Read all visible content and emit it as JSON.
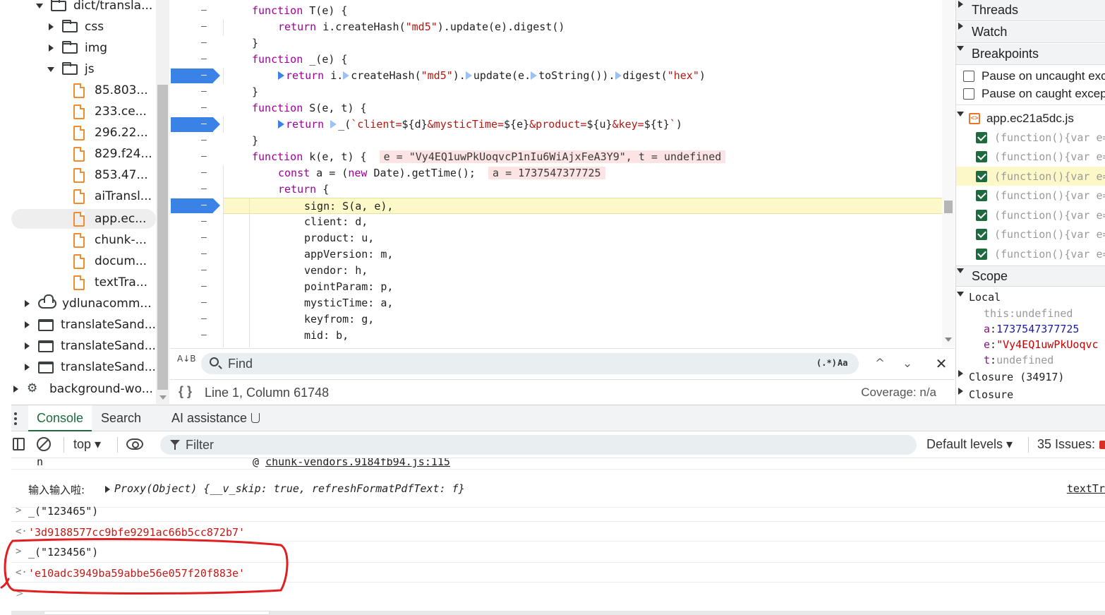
{
  "file_tree": {
    "items": [
      {
        "label": "dict/transla...",
        "type": "folder",
        "expanded": true
      },
      {
        "label": "css",
        "type": "folder",
        "expanded": false
      },
      {
        "label": "img",
        "type": "folder",
        "expanded": false
      },
      {
        "label": "js",
        "type": "folder",
        "expanded": true
      },
      {
        "label": "85.803...",
        "type": "file"
      },
      {
        "label": "233.ce...",
        "type": "file"
      },
      {
        "label": "296.22...",
        "type": "file"
      },
      {
        "label": "829.f24...",
        "type": "file"
      },
      {
        "label": "853.47...",
        "type": "file"
      },
      {
        "label": "aiTransl...",
        "type": "file"
      },
      {
        "label": "app.ec...",
        "type": "file",
        "selected": true
      },
      {
        "label": "chunk-...",
        "type": "file"
      },
      {
        "label": "docum...",
        "type": "file"
      },
      {
        "label": "textTra...",
        "type": "file"
      },
      {
        "label": "ydlunacomm...",
        "type": "cloud"
      },
      {
        "label": "translateSand...",
        "type": "frame"
      },
      {
        "label": "translateSand...",
        "type": "frame"
      },
      {
        "label": "translateSand...",
        "type": "frame"
      },
      {
        "label": "background-wo...",
        "type": "gear"
      }
    ]
  },
  "editor": {
    "gutter_symbol": "–",
    "breakpoint_lines": [
      4,
      7,
      12
    ],
    "lines": [
      {
        "indent": 0,
        "parts": [
          [
            "kw",
            "function"
          ],
          [
            "",
            " T(e) {"
          ]
        ]
      },
      {
        "indent": 1,
        "parts": [
          [
            "kw",
            "return"
          ],
          [
            "",
            " i.createHash("
          ],
          [
            "str",
            "\"md5\""
          ],
          [
            "",
            ").update(e).digest()"
          ]
        ]
      },
      {
        "indent": 0,
        "parts": [
          [
            "",
            "}"
          ]
        ]
      },
      {
        "indent": 0,
        "parts": [
          [
            "kw",
            "function"
          ],
          [
            "",
            " _(e) {"
          ]
        ]
      },
      {
        "indent": 1,
        "parts": [
          [
            "bp",
            ""
          ],
          [
            "kw",
            "return"
          ],
          [
            "",
            " i."
          ],
          [
            "bpoff",
            ""
          ],
          [
            "",
            "createHash("
          ],
          [
            "str",
            "\"md5\""
          ],
          [
            "",
            ")."
          ],
          [
            "bpoff",
            ""
          ],
          [
            "",
            "update(e."
          ],
          [
            "bpoff",
            ""
          ],
          [
            "",
            "toString())."
          ],
          [
            "bpoff",
            ""
          ],
          [
            "",
            "digest("
          ],
          [
            "str",
            "\"hex\""
          ],
          [
            "",
            ")"
          ]
        ]
      },
      {
        "indent": 0,
        "parts": [
          [
            "",
            "}"
          ]
        ]
      },
      {
        "indent": 0,
        "parts": [
          [
            "kw",
            "function"
          ],
          [
            "",
            " S(e, t) {"
          ]
        ]
      },
      {
        "indent": 1,
        "parts": [
          [
            "bp",
            ""
          ],
          [
            "kw",
            "return"
          ],
          [
            "",
            " "
          ],
          [
            "bpoff",
            ""
          ],
          [
            "",
            "_("
          ],
          [
            "str",
            "`client="
          ],
          [
            "",
            "${d}"
          ],
          [
            "str",
            "&mysticTime="
          ],
          [
            "",
            "${e}"
          ],
          [
            "str",
            "&product="
          ],
          [
            "",
            "${u}"
          ],
          [
            "str",
            "&key="
          ],
          [
            "",
            "${t}"
          ],
          [
            "str",
            "`"
          ],
          [
            "",
            ")"
          ]
        ]
      },
      {
        "indent": 0,
        "parts": [
          [
            "",
            "}"
          ]
        ]
      },
      {
        "indent": 0,
        "parts": [
          [
            "kw",
            "function"
          ],
          [
            "",
            " k(e, t) {  "
          ],
          [
            "inline",
            "e = \"Vy4EQ1uwPkUoqvcP1nIu6WiAjxFeA3Y9\", t = undefined"
          ]
        ]
      },
      {
        "indent": 1,
        "parts": [
          [
            "kw",
            "const"
          ],
          [
            "",
            " a = ("
          ],
          [
            "kw",
            "new"
          ],
          [
            "",
            " Date).getTime();  "
          ],
          [
            "inline",
            "a = 1737547377725"
          ]
        ]
      },
      {
        "indent": 1,
        "parts": [
          [
            "kw",
            "return"
          ],
          [
            "",
            " {"
          ]
        ]
      },
      {
        "indent": 2,
        "paused": true,
        "parts": [
          [
            "",
            "sign: S(a, e),"
          ]
        ]
      },
      {
        "indent": 2,
        "parts": [
          [
            "",
            "client: d,"
          ]
        ]
      },
      {
        "indent": 2,
        "parts": [
          [
            "",
            "product: u,"
          ]
        ]
      },
      {
        "indent": 2,
        "parts": [
          [
            "",
            "appVersion: m,"
          ]
        ]
      },
      {
        "indent": 2,
        "parts": [
          [
            "",
            "vendor: h,"
          ]
        ]
      },
      {
        "indent": 2,
        "parts": [
          [
            "",
            "pointParam: p,"
          ]
        ]
      },
      {
        "indent": 2,
        "parts": [
          [
            "",
            "mysticTime: a,"
          ]
        ]
      },
      {
        "indent": 2,
        "parts": [
          [
            "",
            "keyfrom: g,"
          ]
        ]
      },
      {
        "indent": 2,
        "parts": [
          [
            "",
            "mid: b,"
          ]
        ]
      }
    ]
  },
  "find_bar": {
    "replace_toggle": "A↓B",
    "placeholder": "Find",
    "regex_option": "(.*)",
    "case_option": "Aa",
    "prev_symbol": "^",
    "next_symbol": "⌄",
    "close_symbol": "✕"
  },
  "status_bar": {
    "braces": "{ }",
    "position": "Line 1, Column 61748",
    "coverage": "Coverage: n/a"
  },
  "debugger_pane": {
    "sections": {
      "threads": "Threads",
      "watch": "Watch",
      "breakpoints": "Breakpoints",
      "scope": "Scope"
    },
    "pause_uncaught": "Pause on uncaught exc",
    "pause_caught": "Pause on caught excep",
    "bp_file": "app.ec21a5dc.js",
    "bp_file_icon": "<>",
    "bp_entries": [
      {
        "text": "(function(){var e=",
        "checked": true,
        "highlight": false
      },
      {
        "text": "(function(){var e=",
        "checked": true,
        "highlight": false
      },
      {
        "text": "(function(){var e=",
        "checked": true,
        "highlight": true
      },
      {
        "text": "(function(){var e=",
        "checked": true,
        "highlight": false
      },
      {
        "text": "(function(){var e=",
        "checked": true,
        "highlight": false
      },
      {
        "text": "(function(){var e=",
        "checked": true,
        "highlight": false
      },
      {
        "text": "(function(){var e=",
        "checked": true,
        "highlight": false
      }
    ],
    "scope": {
      "local_label": "Local",
      "vars": [
        {
          "key": "this",
          "value": "undefined",
          "kind": "undef",
          "dim": true
        },
        {
          "key": "a",
          "value": "1737547377725",
          "kind": "num",
          "dim": false
        },
        {
          "key": "e",
          "value": "\"Vy4EQ1uwPkUoqvc",
          "kind": "str",
          "dim": false
        },
        {
          "key": "t",
          "value": "undefined",
          "kind": "undef",
          "dim": false
        }
      ],
      "closure_1": "Closure (34917)",
      "closure_2": "Closure"
    }
  },
  "drawer": {
    "tabs": [
      "Console",
      "Search",
      "AI assistance"
    ],
    "active_tab": "Console"
  },
  "console_toolbar": {
    "context": "top ▾",
    "filter_placeholder": "Filter",
    "levels": "Default levels ▾",
    "issues": "35 Issues:"
  },
  "console": {
    "rows": [
      {
        "type": "log-tail",
        "left": "n",
        "at": "@ ",
        "link": "chunk-vendors.9184fb94.js:115"
      },
      {
        "type": "log",
        "label": "输入输入啦:",
        "object": "Proxy(Object) {__v_skip: true, refreshFormatPdfText: f}",
        "source": "textTr"
      },
      {
        "type": "input",
        "prompt": ">",
        "text": "_(\"123465\")"
      },
      {
        "type": "result",
        "prompt": "<·",
        "text": "'3d9188577cc9bfe9291ac66b5cc872b7'"
      },
      {
        "type": "input",
        "prompt": ">",
        "text": "_(\"123456\")"
      },
      {
        "type": "result",
        "prompt": "<·",
        "text": "'e10adc3949ba59abbe56e057f20f883e'"
      }
    ],
    "prompt_symbol": ">"
  },
  "colors": {
    "accent": "#1e6a3e",
    "breakpoint": "#3b82e6",
    "paused_line": "#fdf8c8",
    "annotation": "#e02020"
  }
}
